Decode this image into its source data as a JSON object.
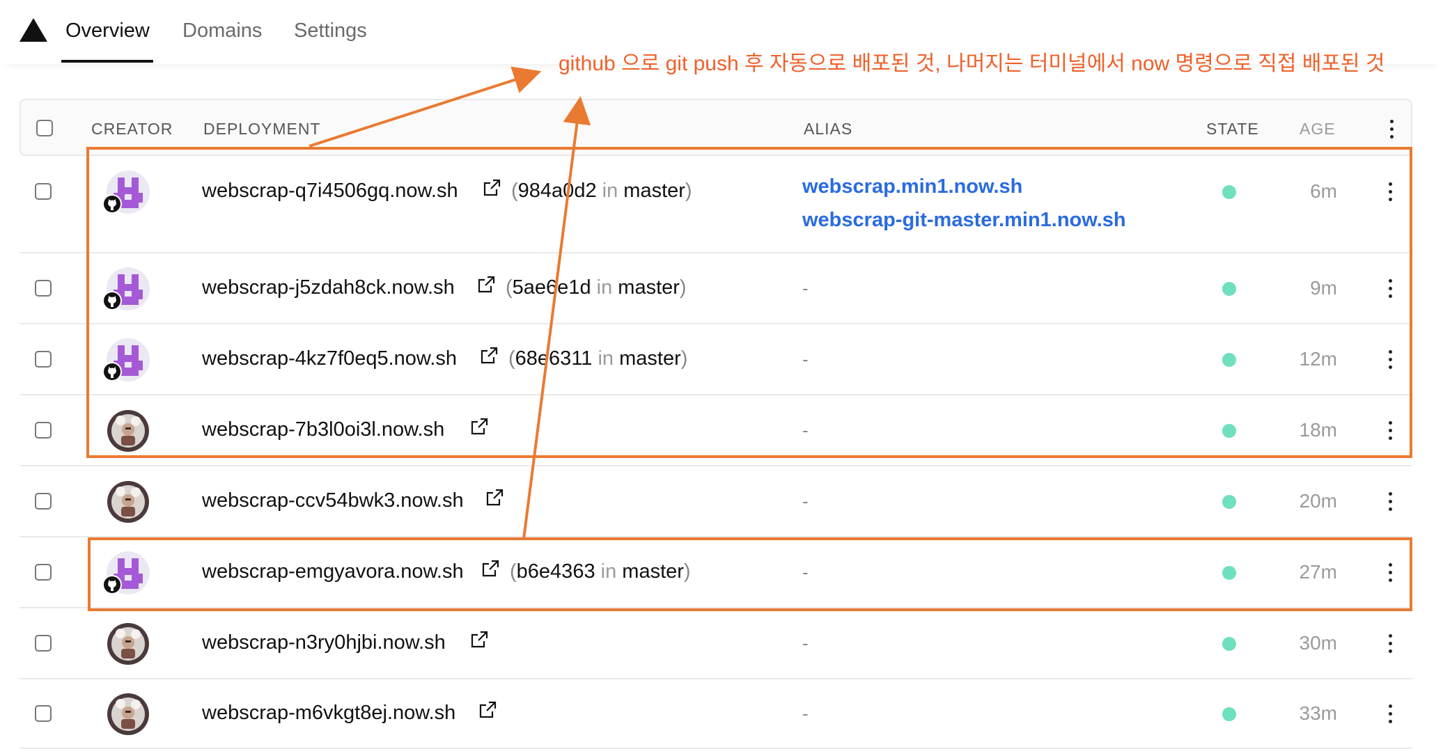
{
  "tabs": [
    {
      "label": "Overview",
      "active": true
    },
    {
      "label": "Domains",
      "active": false
    },
    {
      "label": "Settings",
      "active": false
    }
  ],
  "table_headers": {
    "creator": "CREATOR",
    "deployment": "DEPLOYMENT",
    "alias": "ALIAS",
    "state": "STATE",
    "age": "AGE"
  },
  "rows": [
    {
      "creator": "github-bot",
      "url": "webscrap-q7i4506gq.now.sh",
      "commit": "984a0d2",
      "commit_in": "in",
      "branch": "master",
      "aliases": [
        "webscrap.min1.now.sh",
        "webscrap-git-master.min1.now.sh"
      ],
      "age": "6m"
    },
    {
      "creator": "github-bot",
      "url": "webscrap-j5zdah8ck.now.sh",
      "commit": "5ae6e1d",
      "commit_in": "in",
      "branch": "master",
      "alias_empty": "-",
      "age": "9m"
    },
    {
      "creator": "github-bot",
      "url": "webscrap-4kz7f0eq5.now.sh",
      "commit": "68e6311",
      "commit_in": "in",
      "branch": "master",
      "alias_empty": "-",
      "age": "12m"
    },
    {
      "creator": "user",
      "url": "webscrap-7b3l0oi3l.now.sh",
      "alias_empty": "-",
      "age": "18m"
    },
    {
      "creator": "user",
      "url": "webscrap-ccv54bwk3.now.sh",
      "alias_empty": "-",
      "age": "20m"
    },
    {
      "creator": "github-bot",
      "url": "webscrap-emgyavora.now.sh",
      "commit": "b6e4363",
      "commit_in": "in",
      "branch": "master",
      "alias_empty": "-",
      "age": "27m"
    },
    {
      "creator": "user",
      "url": "webscrap-n3ry0hjbi.now.sh",
      "alias_empty": "-",
      "age": "30m"
    },
    {
      "creator": "user",
      "url": "webscrap-m6vkgt8ej.now.sh",
      "alias_empty": "-",
      "age": "33m"
    }
  ],
  "annotation": {
    "text": "github 으로 git push 후 자동으로 배포된 것, 나머지는 터미널에서 now 명령으로 직접 배포된 것",
    "color": "#f0602a"
  },
  "colors": {
    "accent_link": "#2a6be0",
    "state_ready": "#6ee0bd",
    "bot_avatar": "#a45ad6"
  }
}
